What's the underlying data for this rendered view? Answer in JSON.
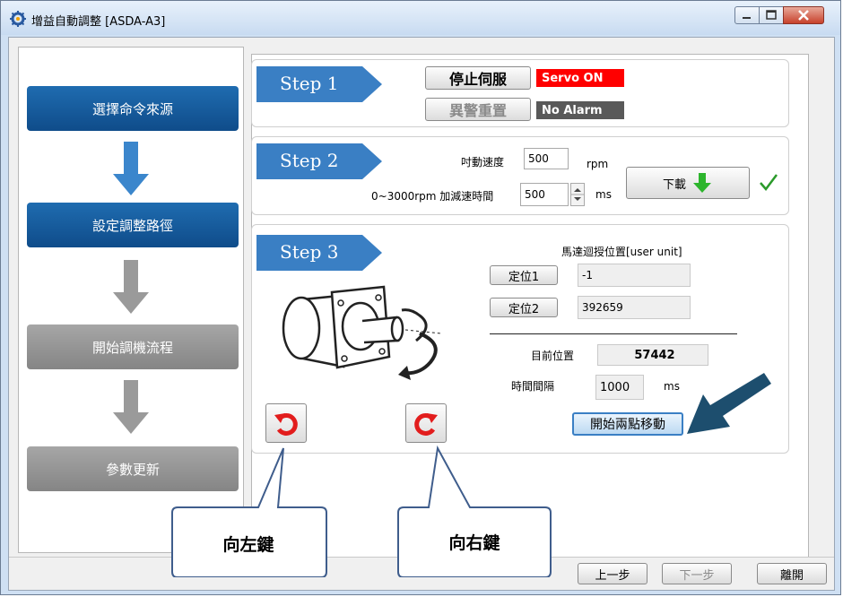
{
  "window": {
    "title": "增益自動調整 [ASDA-A3]"
  },
  "nav": [
    {
      "label": "選擇命令來源"
    },
    {
      "label": "設定調整路徑"
    },
    {
      "label": "開始調機流程"
    },
    {
      "label": "參數更新"
    }
  ],
  "step1": {
    "label": "Step 1",
    "servo_button": "停止伺服",
    "servo_status": "Servo ON",
    "alarm_button": "異警重置",
    "alarm_status": "No Alarm",
    "colors": {
      "servo_on": "#ff0000",
      "no_alarm": "#595959"
    }
  },
  "step2": {
    "label": "Step 2",
    "jog_label": "吋動速度",
    "jog_value": "500",
    "jog_unit": "rpm",
    "accel_label": "0~3000rpm 加減速時間",
    "accel_value": "500",
    "accel_unit": "ms",
    "download_button": "下載"
  },
  "step3": {
    "label": "Step 3",
    "feedback_title": "馬達迴授位置[user unit]",
    "pos1_button": "定位1",
    "pos1_value": "-1",
    "pos2_button": "定位2",
    "pos2_value": "392659",
    "current_label": "目前位置",
    "current_value": "57442",
    "interval_label": "時間間隔",
    "interval_value": "1000",
    "interval_unit": "ms",
    "start_button": "開始兩點移動"
  },
  "bottom": {
    "prev": "上一步",
    "next": "下一步",
    "exit": "離開"
  },
  "callouts": {
    "left": "向左鍵",
    "right": "向右鍵"
  }
}
